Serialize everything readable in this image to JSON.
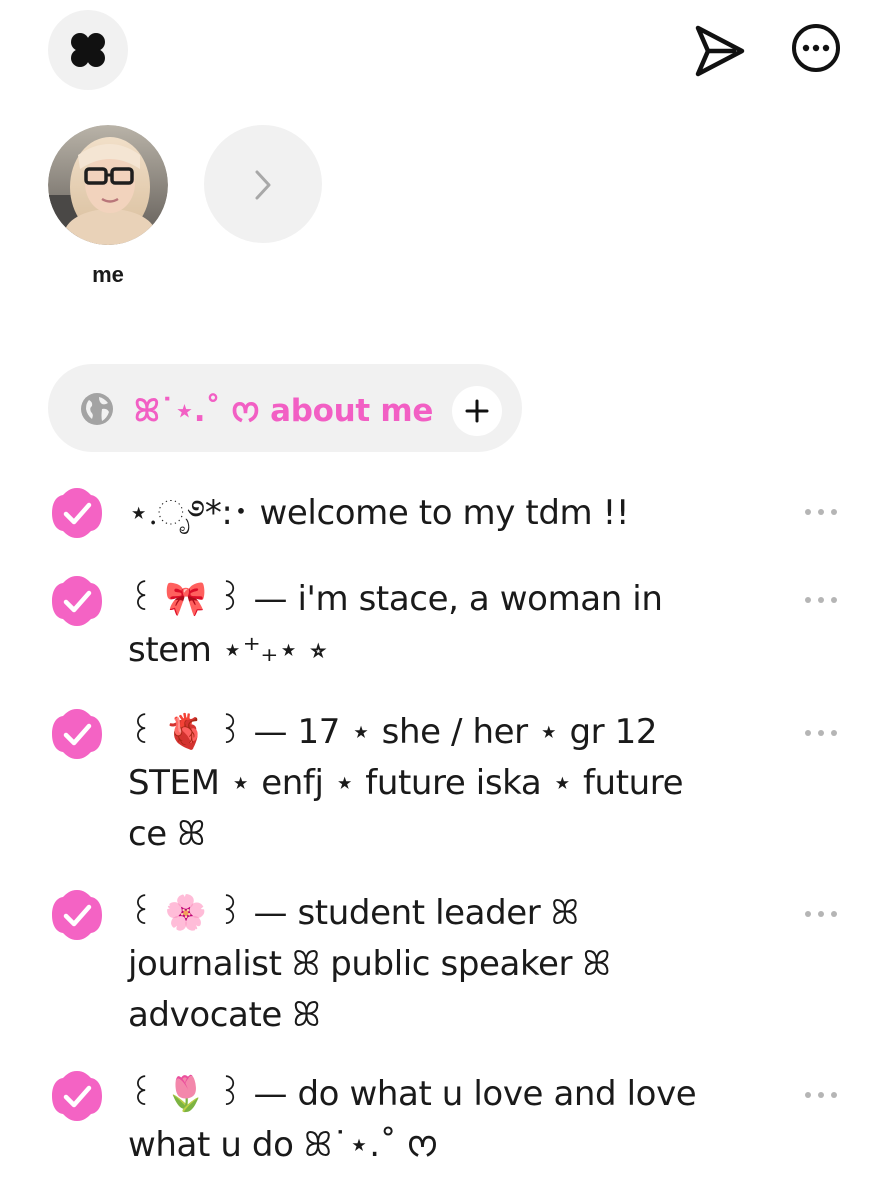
{
  "profile": {
    "label": "me"
  },
  "list": {
    "title": "ꕤ˙⋆.˚ ᰔ about me",
    "accent_color": "#f25fc4"
  },
  "todos": [
    {
      "text": "⋆.ೃ࿔*:･ welcome to my tdm !!"
    },
    {
      "text": "꒰ 🎀 ꒱ —  i'm stace, a woman in stem  ⋆⁺₊⋆ ⭒"
    },
    {
      "text": "꒰ 🫀 ꒱ — 17 ⋆ she / her ⋆ gr 12 STEM ⋆ enfj ⋆ future iska ⋆ future ce ꕤ"
    },
    {
      "text": "꒰ 🌸 ꒱ — student leader ꕤ journalist ꕤ public speaker ꕤ advocate ꕤ"
    },
    {
      "text": "꒰ 🌷 ꒱ — do what u love and love what u do ꕤ˙⋆.˚ ᰔ"
    }
  ],
  "icons": {
    "logo": "app-logo-icon",
    "send": "send-icon",
    "more": "more-options-icon",
    "next": "chevron-right-icon",
    "globe": "globe-icon",
    "add": "plus-icon",
    "check": "checkbox-checked-icon",
    "item_menu": "ellipsis-icon"
  },
  "colors": {
    "check_fill": "#f463c4",
    "chip_bg": "#f1f1f1",
    "muted_icon": "#a0a0a0"
  }
}
